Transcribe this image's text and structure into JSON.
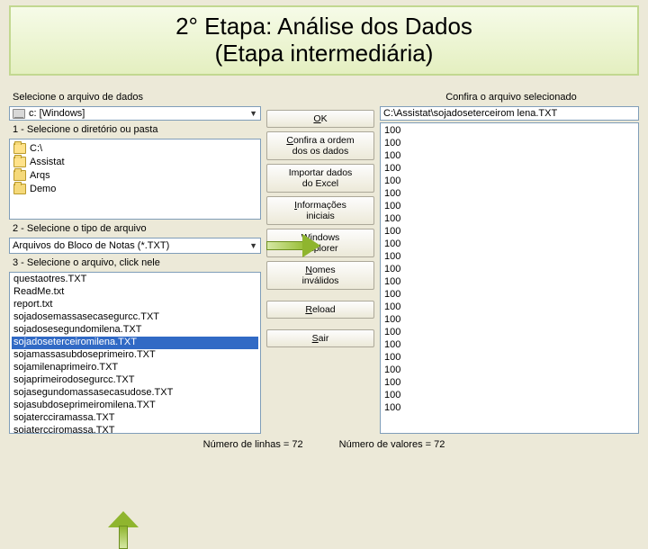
{
  "title": {
    "line1": "2° Etapa: Análise dos Dados",
    "line2": "(Etapa intermediária)"
  },
  "labels": {
    "select_file": "Selecione o arquivo de dados",
    "confirm_file": "Confira o arquivo selecionado",
    "step1": "1 - Selecione o diretório ou pasta",
    "step2": "2 - Selecione o tipo de arquivo",
    "step3": "3 - Selecione o arquivo, click nele"
  },
  "drive": "c: [Windows]",
  "dirs": [
    "C:\\",
    "Assistat",
    "Arqs",
    "Demo"
  ],
  "filetype": "Arquivos do Bloco de Notas (*.TXT)",
  "files": [
    "questaotres.TXT",
    "ReadMe.txt",
    "report.txt",
    "sojadosemassasecasegurcc.TXT",
    "sojadosesegundomilena.TXT",
    "sojadoseterceiromilena.TXT",
    "sojamassasubdoseprimeiro.TXT",
    "sojamilenaprimeiro.TXT",
    "sojaprimeirodosegurcc.TXT",
    "sojasegundomassasecasudose.TXT",
    "sojasubdoseprimeiromilena.TXT",
    "sojatercciramassa.TXT",
    "sojatercciromassa.TXT"
  ],
  "selected_file_index": 5,
  "buttons": {
    "ok": "OK",
    "confira": [
      "Confira a ordem",
      "dos os dados"
    ],
    "importar": [
      "Importar dados",
      "do Excel"
    ],
    "info": [
      "Informações",
      "iniciais"
    ],
    "explorer": [
      "Windows",
      "Explorer"
    ],
    "nomes": [
      "Nomes",
      "inválidos"
    ],
    "reload": "Reload",
    "sair": "Sair"
  },
  "selected_path": "C:\\Assistat\\sojadoseterceirom lena.TXT",
  "preview_lines": [
    "100",
    "100",
    "100",
    "100",
    "100",
    "100",
    "100",
    "100",
    "100",
    "100",
    "100",
    "100",
    "100",
    "100",
    "100",
    "100",
    "100",
    "100",
    "100",
    "100",
    "100",
    "100",
    "100"
  ],
  "status": {
    "linhas": "Número de linhas = 72",
    "valores": "Número de valores = 72"
  }
}
